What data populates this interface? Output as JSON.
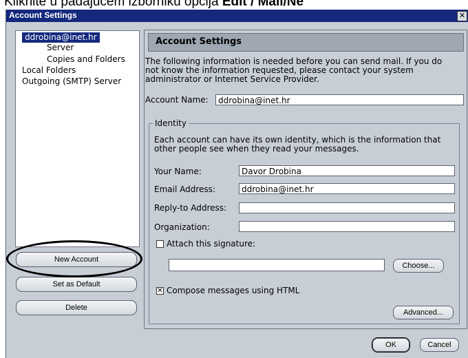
{
  "caption": {
    "text": "Kliknite u padajućem izborniku opcija ",
    "bold": "Edit / Mail/Ne"
  },
  "window": {
    "title": "Account Settings",
    "close_glyph": "✕"
  },
  "tree": {
    "items": [
      "ddrobina@inet.hr",
      "Server",
      "Copies and Folders",
      "Local Folders",
      "Outgoing (SMTP) Server"
    ],
    "selected_index": 0
  },
  "left_buttons": {
    "new_account": "New Account",
    "set_default": "Set as Default",
    "delete": "Delete"
  },
  "panel": {
    "header": "Account Settings",
    "intro": [
      "The following information is needed before you can send mail. If you do",
      "not know the information requested, please contact your system",
      "administrator or Internet Service Provider."
    ],
    "account_name_label": "Account Name:",
    "account_name_value": "ddrobina@inet.hr",
    "identity": {
      "legend": "Identity",
      "desc": [
        "Each account can have its own identity, which is the information that",
        "other people see when they read your messages."
      ],
      "your_name_label": "Your Name:",
      "your_name_value": "Davor Drobina",
      "email_label": "Email Address:",
      "email_value": "ddrobina@inet.hr",
      "reply_label": "Reply-to Address:",
      "reply_value": "",
      "org_label": "Organization:",
      "org_value": "",
      "attach_label": "Attach this signature:",
      "attach_checked": false,
      "signature_value": "",
      "choose": "Choose...",
      "compose_label": "Compose messages using HTML",
      "compose_checked": true,
      "advanced": "Advanced..."
    }
  },
  "dialog_buttons": {
    "ok": "OK",
    "cancel": "Cancel"
  },
  "colors": {
    "titlebar": "#14297d",
    "window_bg": "#c8ced6",
    "annotation": "#000000"
  }
}
